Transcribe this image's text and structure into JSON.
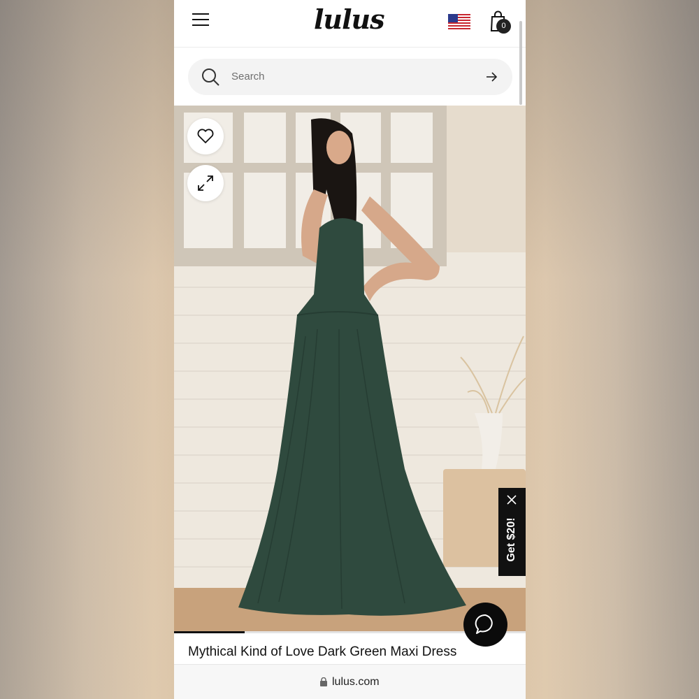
{
  "header": {
    "logo_text": "lulus",
    "menu_icon": "hamburger-menu-icon",
    "flag_icon": "us-flag-icon",
    "cart_icon": "shopping-bag-icon",
    "cart_count": "0"
  },
  "search": {
    "placeholder": "Search",
    "icon": "search-icon",
    "submit_icon": "arrow-right-icon"
  },
  "product": {
    "title": "Mythical Kind of Love Dark Green Maxi Dress",
    "dress_color": "#2f4a3e",
    "wishlist_icon": "heart-icon",
    "expand_icon": "expand-icon",
    "image_progress": 0.2
  },
  "promo": {
    "label": "Get $20!",
    "close_icon": "close-icon"
  },
  "chat": {
    "icon": "chat-bubble-icon"
  },
  "browser": {
    "url": "lulus.com",
    "lock_icon": "lock-icon"
  }
}
